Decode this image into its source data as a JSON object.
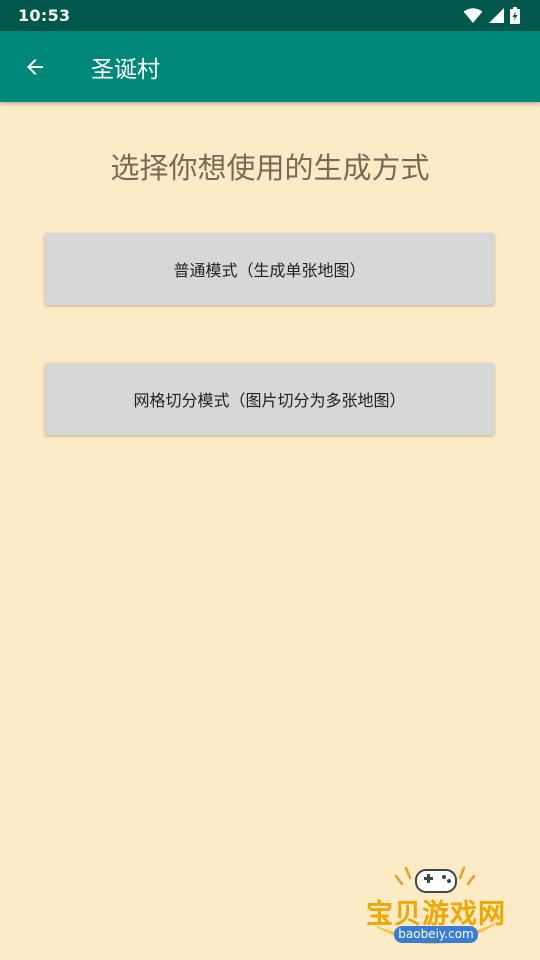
{
  "status_bar": {
    "time": "10:53"
  },
  "app_bar": {
    "title": "圣诞村"
  },
  "main": {
    "heading": "选择你想使用的生成方式",
    "buttons": [
      {
        "label": "普通模式（生成单张地图）"
      },
      {
        "label": "网格切分模式（图片切分为多张地图）"
      }
    ]
  },
  "watermark": {
    "name": "宝贝游戏网",
    "url": "baobeiy.com"
  },
  "colors": {
    "status_bar": "#00574b",
    "app_bar": "#00897b",
    "background": "#fdebc8",
    "button": "#d6d7d7"
  },
  "icons": [
    "wifi-icon",
    "cellular-signal-icon",
    "battery-charging-icon",
    "back-arrow-icon"
  ]
}
